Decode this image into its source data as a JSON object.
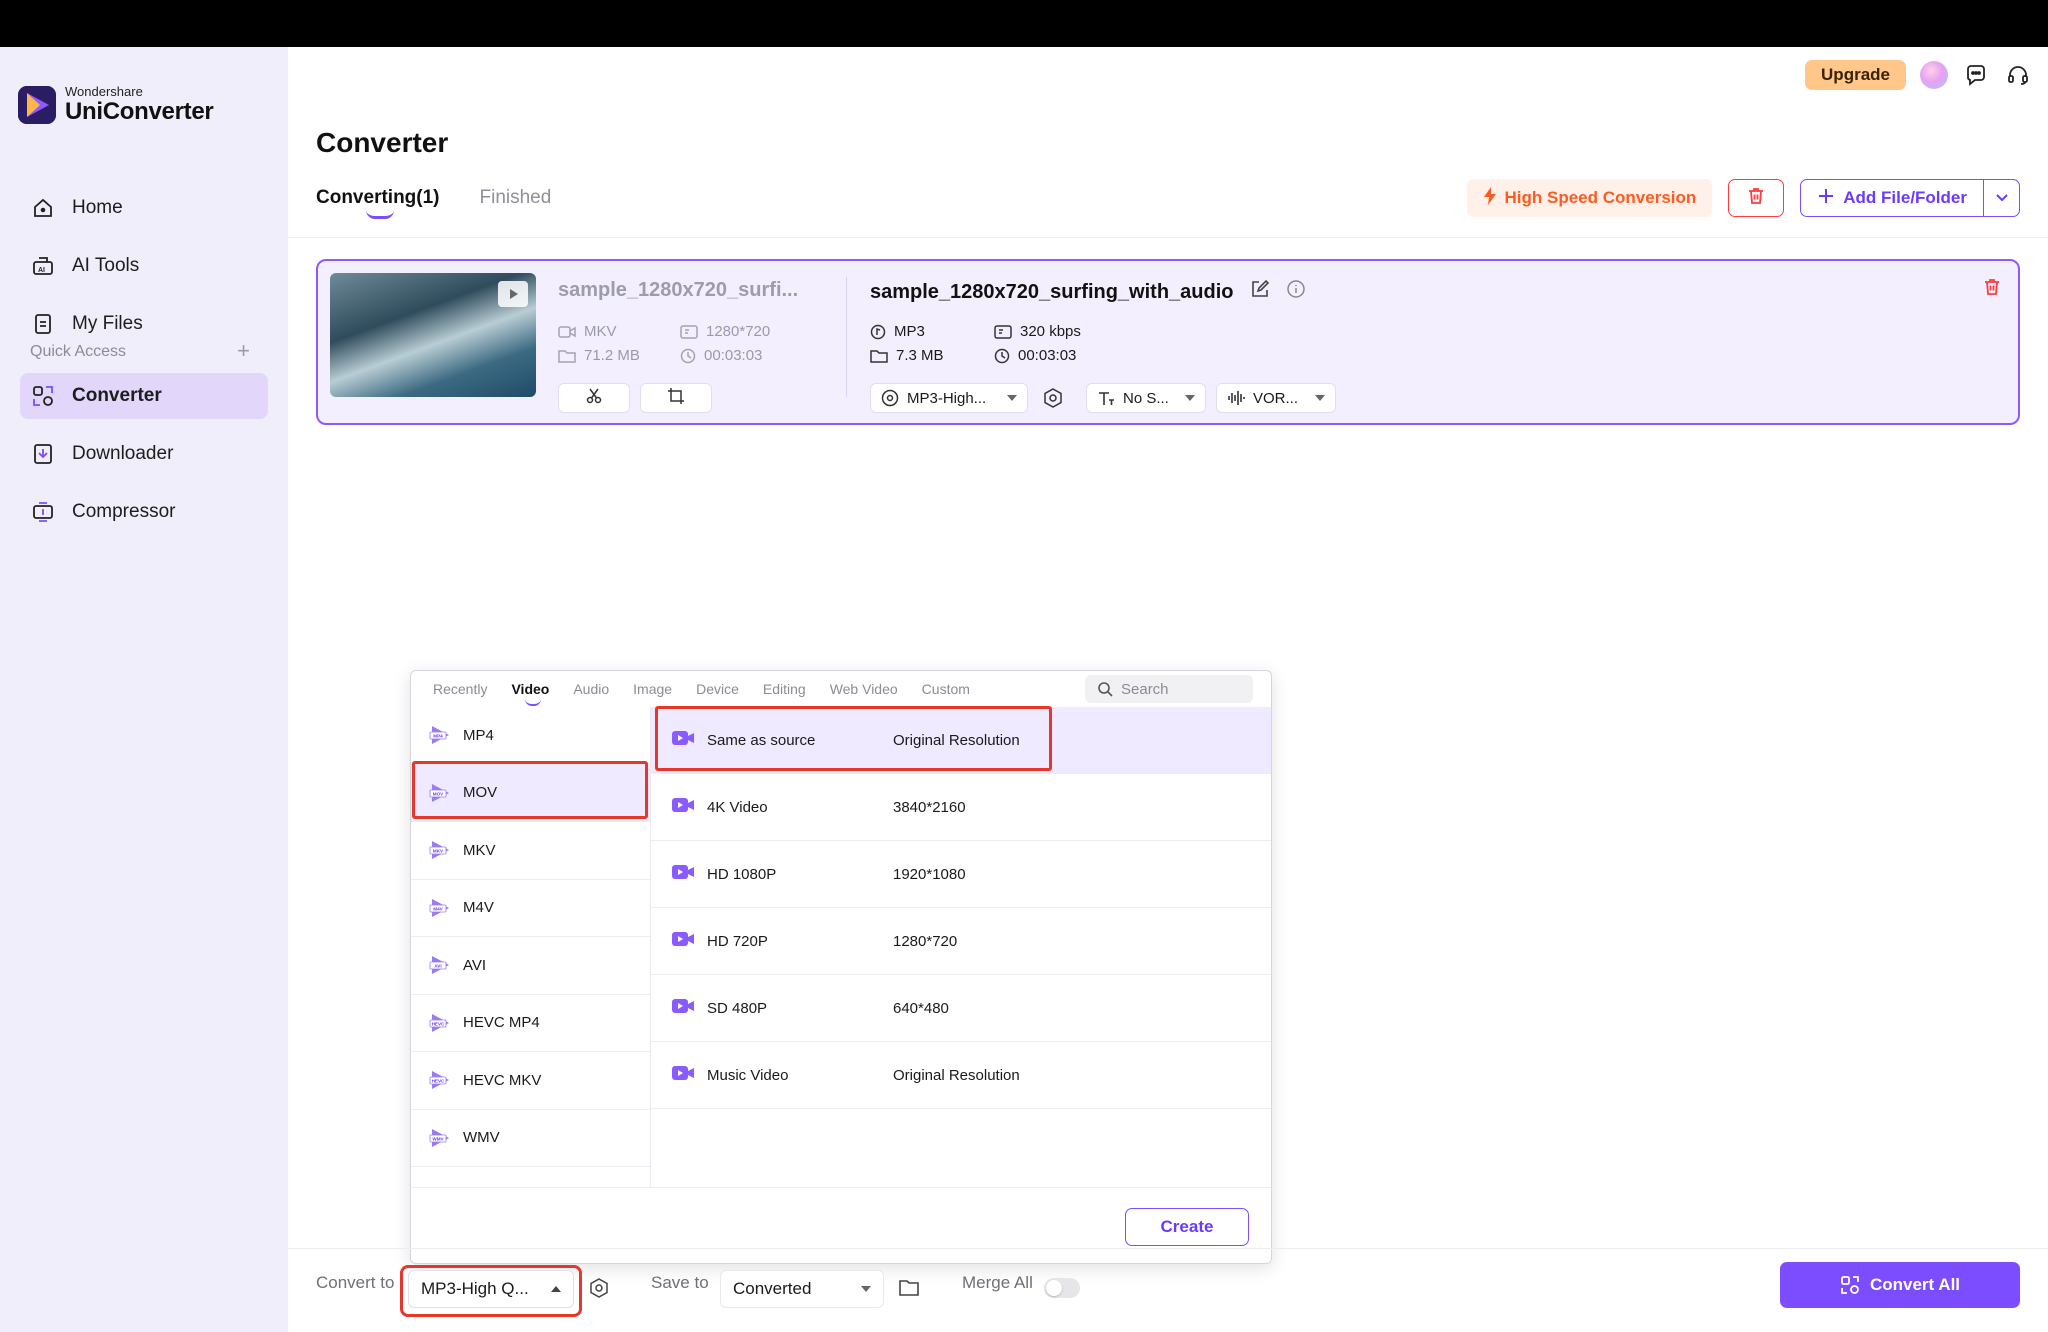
{
  "app": {
    "brand_sub": "Wondershare",
    "brand_main": "UniConverter"
  },
  "sidebar": {
    "items": [
      {
        "label": "Home",
        "icon": "home-icon"
      },
      {
        "label": "AI Tools",
        "icon": "ai-tools-icon"
      },
      {
        "label": "My Files",
        "icon": "files-icon"
      }
    ],
    "quick_access_label": "Quick Access",
    "quick_items": [
      {
        "label": "Converter",
        "icon": "converter-icon",
        "active": true
      },
      {
        "label": "Downloader",
        "icon": "downloader-icon"
      },
      {
        "label": "Compressor",
        "icon": "compressor-icon"
      }
    ]
  },
  "header": {
    "upgrade_label": "Upgrade"
  },
  "page": {
    "title": "Converter"
  },
  "tabs": [
    {
      "label": "Converting(1)",
      "active": true
    },
    {
      "label": "Finished"
    }
  ],
  "toolbar": {
    "high_speed_label": "High Speed Conversion",
    "add_label": "Add File/Folder"
  },
  "file": {
    "source_name": "sample_1280x720_surfi...",
    "source_format": "MKV",
    "source_resolution": "1280*720",
    "source_size": "71.2 MB",
    "source_duration": "00:03:03",
    "output_name": "sample_1280x720_surfing_with_audio",
    "output_format": "MP3",
    "output_bitrate": "320 kbps",
    "output_size": "7.3 MB",
    "output_duration": "00:03:03",
    "preset_label": "MP3-High...",
    "subtitle_label": "No S...",
    "audio_label": "VOR..."
  },
  "popup": {
    "tabs": [
      "Recently",
      "Video",
      "Audio",
      "Image",
      "Device",
      "Editing",
      "Web Video",
      "Custom"
    ],
    "active_tab": "Video",
    "search_placeholder": "Search",
    "formats": [
      {
        "label": "MP4",
        "badge": "MP4"
      },
      {
        "label": "MOV",
        "badge": "MOV",
        "active": true
      },
      {
        "label": "MKV",
        "badge": "MKV"
      },
      {
        "label": "M4V",
        "badge": "M4V"
      },
      {
        "label": "AVI",
        "badge": "AVI"
      },
      {
        "label": "HEVC MP4",
        "badge": "HEVC"
      },
      {
        "label": "HEVC MKV",
        "badge": "HEVC"
      },
      {
        "label": "WMV",
        "badge": "WMV"
      }
    ],
    "resolutions": [
      {
        "name": "Same as source",
        "value": "Original Resolution",
        "active": true
      },
      {
        "name": "4K Video",
        "value": "3840*2160"
      },
      {
        "name": "HD 1080P",
        "value": "1920*1080"
      },
      {
        "name": "HD 720P",
        "value": "1280*720"
      },
      {
        "name": "SD 480P",
        "value": "640*480"
      },
      {
        "name": "Music Video",
        "value": "Original Resolution"
      }
    ],
    "create_label": "Create"
  },
  "bottom": {
    "convert_to_label": "Convert to",
    "convert_to_value": "MP3-High Q...",
    "save_to_label": "Save to",
    "save_to_value": "Converted",
    "merge_label": "Merge All",
    "convert_all_label": "Convert All"
  },
  "colors": {
    "accent": "#7b4dff",
    "highlight": "#e5372c",
    "warning": "#ff5a1f"
  }
}
